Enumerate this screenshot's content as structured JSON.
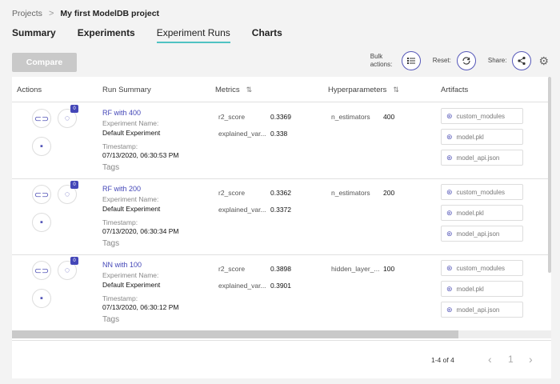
{
  "breadcrumb": {
    "root": "Projects",
    "separator": ">",
    "current": "My first ModelDB project"
  },
  "tabs": [
    {
      "label": "Summary"
    },
    {
      "label": "Experiments"
    },
    {
      "label": "Experiment Runs",
      "active": true
    },
    {
      "label": "Charts"
    }
  ],
  "toolbar": {
    "compare_label": "Compare",
    "bulk_label": "Bulk actions:",
    "reset_label": "Reset:",
    "share_label": "Share:",
    "icons": {
      "bulk": "list-icon",
      "reset": "refresh-icon",
      "share": "share-icon",
      "settings": "gear-icon"
    }
  },
  "table": {
    "columns": {
      "actions": "Actions",
      "run_summary": "Run Summary",
      "metrics": "Metrics",
      "hyperparameters": "Hyperparameters",
      "artifacts": "Artifacts"
    },
    "rows": [
      {
        "name": "RF with 400",
        "experiment_label": "Experiment Name:",
        "experiment": "Default Experiment",
        "timestamp_label": "Timestamp:",
        "timestamp": "07/13/2020, 06:30:53 PM",
        "tags_label": "Tags",
        "comment_count": "0",
        "metrics": [
          {
            "key": "r2_score",
            "value": "0.3369"
          },
          {
            "key": "explained_var...",
            "value": "0.338"
          }
        ],
        "hyperparameters": [
          {
            "key": "n_estimators",
            "value": "400"
          }
        ],
        "artifacts": [
          "custom_modules",
          "model.pkl",
          "model_api.json"
        ]
      },
      {
        "name": "RF with 200",
        "experiment_label": "Experiment Name:",
        "experiment": "Default Experiment",
        "timestamp_label": "Timestamp:",
        "timestamp": "07/13/2020, 06:30:34 PM",
        "tags_label": "Tags",
        "comment_count": "0",
        "metrics": [
          {
            "key": "r2_score",
            "value": "0.3362"
          },
          {
            "key": "explained_var...",
            "value": "0.3372"
          }
        ],
        "hyperparameters": [
          {
            "key": "n_estimators",
            "value": "200"
          }
        ],
        "artifacts": [
          "custom_modules",
          "model.pkl",
          "model_api.json"
        ]
      },
      {
        "name": "NN with 100",
        "experiment_label": "Experiment Name:",
        "experiment": "Default Experiment",
        "timestamp_label": "Timestamp:",
        "timestamp": "07/13/2020, 06:30:12 PM",
        "tags_label": "Tags",
        "comment_count": "0",
        "metrics": [
          {
            "key": "r2_score",
            "value": "0.3898"
          },
          {
            "key": "explained_var...",
            "value": "0.3901"
          }
        ],
        "hyperparameters": [
          {
            "key": "hidden_layer_...",
            "value": "100"
          }
        ],
        "artifacts": [
          "custom_modules",
          "model.pkl",
          "model_api.json"
        ]
      }
    ]
  },
  "pagination": {
    "summary": "1-4 of 4",
    "current_page": "1",
    "prev": "‹",
    "next": "›"
  },
  "colors": {
    "accent": "#4447b8",
    "tab_underline": "#4fc3c3",
    "compare_disabled": "#c9c9c9"
  }
}
